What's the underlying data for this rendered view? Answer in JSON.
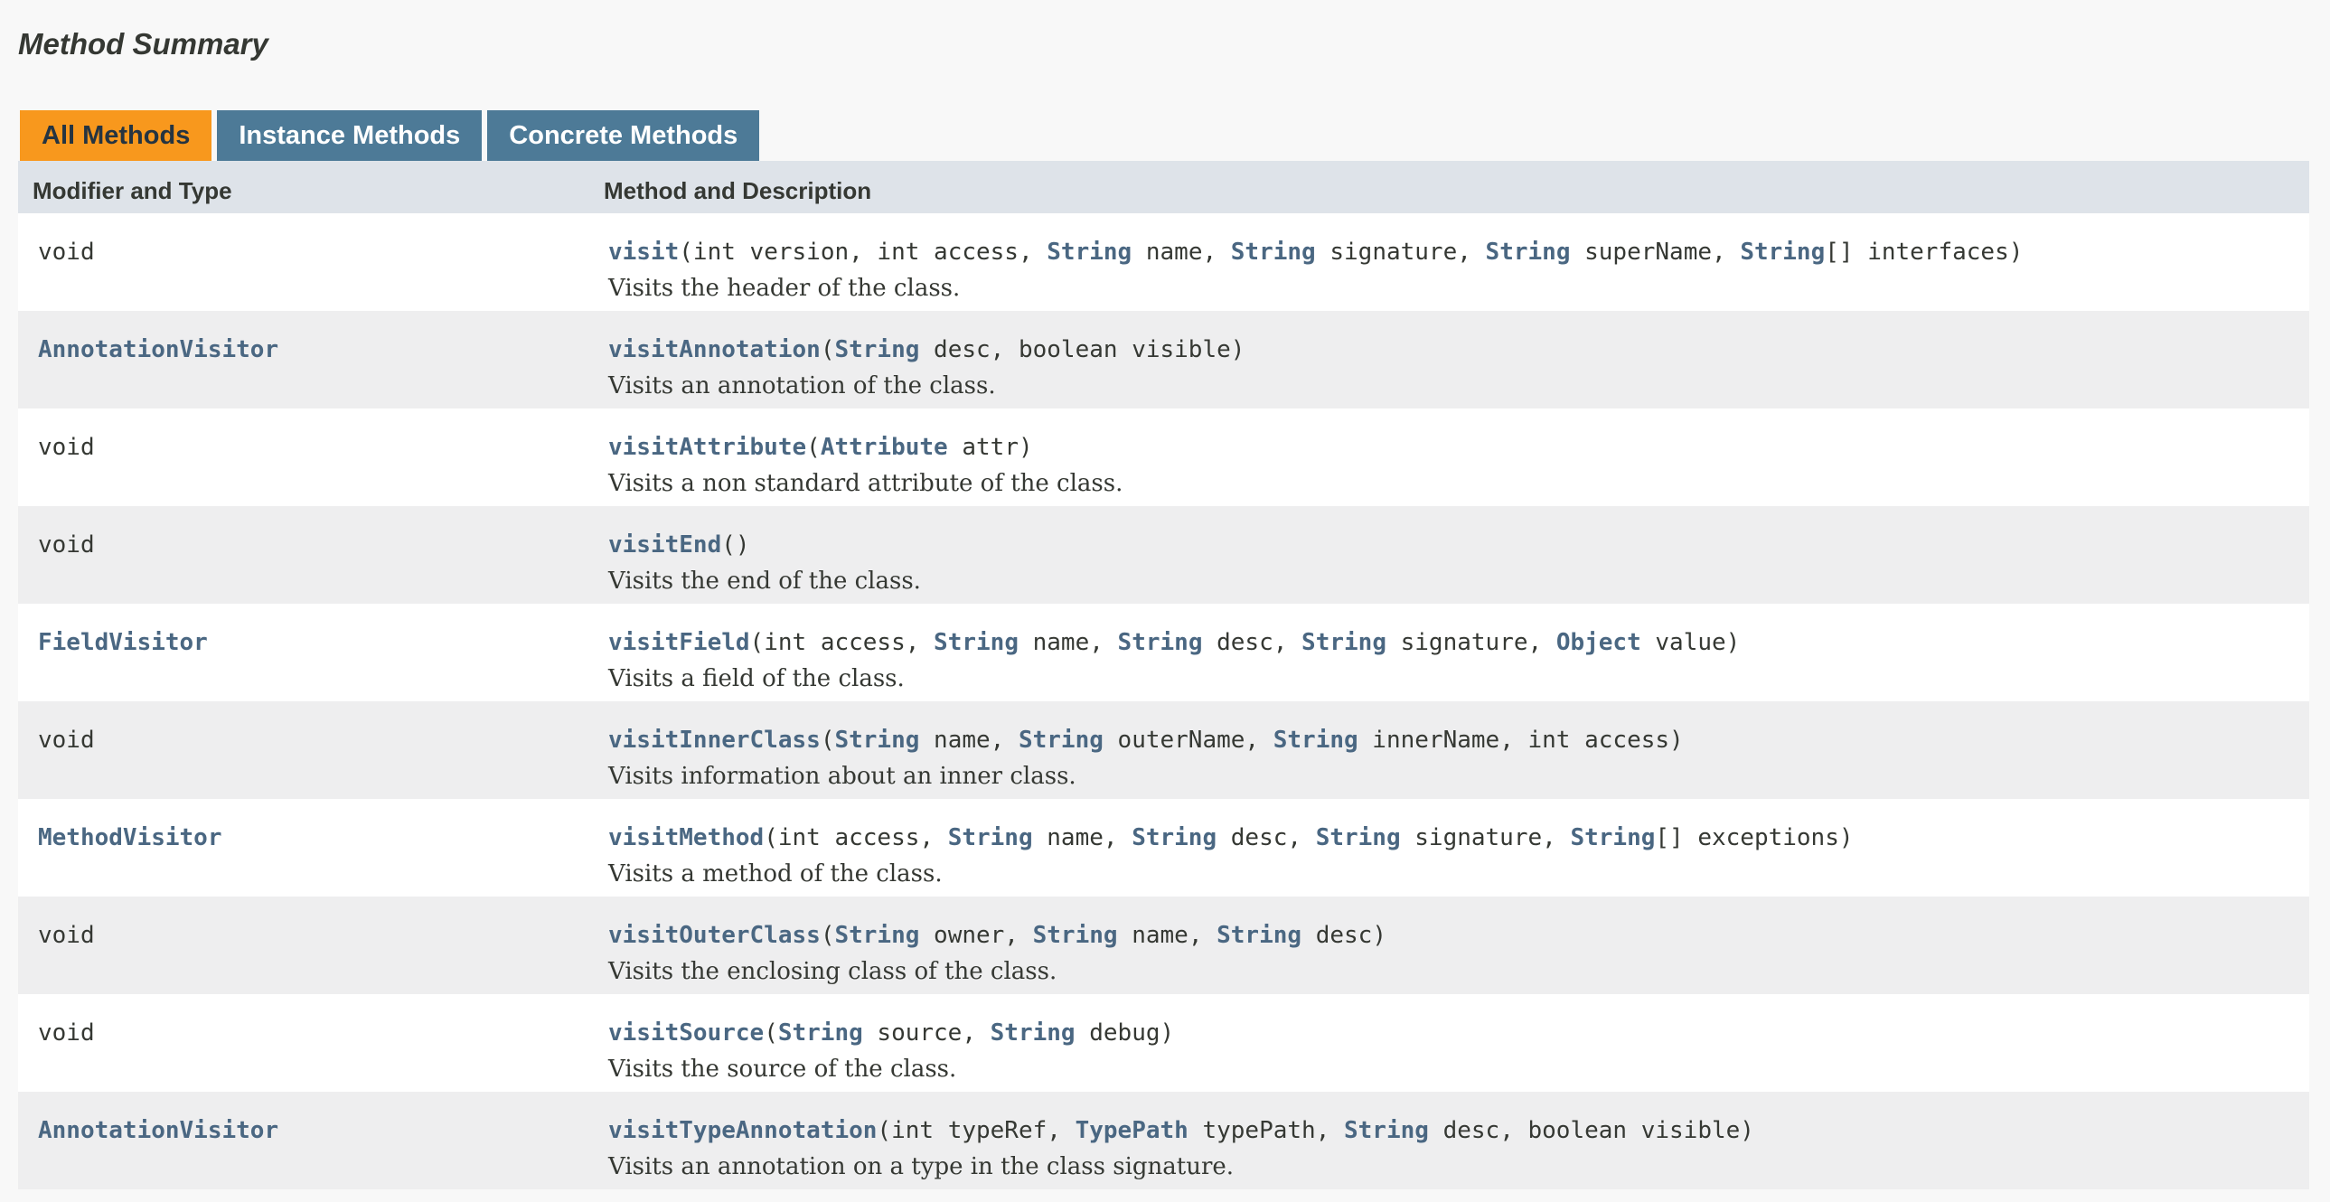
{
  "section": {
    "title": "Method Summary"
  },
  "tabs": [
    {
      "label": "All Methods",
      "active": true
    },
    {
      "label": "Instance Methods",
      "active": false
    },
    {
      "label": "Concrete Methods",
      "active": false
    }
  ],
  "columns": {
    "modifier": "Modifier and Type",
    "method": "Method and Description"
  },
  "colors": {
    "active_tab": "#f8981d",
    "tab": "#4d7a97",
    "link": "#4a6782",
    "header_bg": "#dee3e9",
    "alt_row": "#eeeeef"
  },
  "rows": [
    {
      "type": "void",
      "type_link": false,
      "sig": [
        {
          "k": "m",
          "t": "visit"
        },
        {
          "k": "p",
          "t": "(int version, int access, "
        },
        {
          "k": "t",
          "t": "String"
        },
        {
          "k": "p",
          "t": " name, "
        },
        {
          "k": "t",
          "t": "String"
        },
        {
          "k": "p",
          "t": " signature, "
        },
        {
          "k": "t",
          "t": "String"
        },
        {
          "k": "p",
          "t": " superName, "
        },
        {
          "k": "t",
          "t": "String"
        },
        {
          "k": "p",
          "t": "[] interfaces)"
        }
      ],
      "desc": "Visits the header of the class."
    },
    {
      "type": "AnnotationVisitor",
      "type_link": true,
      "sig": [
        {
          "k": "m",
          "t": "visitAnnotation"
        },
        {
          "k": "p",
          "t": "("
        },
        {
          "k": "t",
          "t": "String"
        },
        {
          "k": "p",
          "t": " desc, boolean visible)"
        }
      ],
      "desc": "Visits an annotation of the class."
    },
    {
      "type": "void",
      "type_link": false,
      "sig": [
        {
          "k": "m",
          "t": "visitAttribute"
        },
        {
          "k": "p",
          "t": "("
        },
        {
          "k": "t",
          "t": "Attribute"
        },
        {
          "k": "p",
          "t": " attr)"
        }
      ],
      "desc": "Visits a non standard attribute of the class."
    },
    {
      "type": "void",
      "type_link": false,
      "sig": [
        {
          "k": "m",
          "t": "visitEnd"
        },
        {
          "k": "p",
          "t": "()"
        }
      ],
      "desc": "Visits the end of the class."
    },
    {
      "type": "FieldVisitor",
      "type_link": true,
      "sig": [
        {
          "k": "m",
          "t": "visitField"
        },
        {
          "k": "p",
          "t": "(int access, "
        },
        {
          "k": "t",
          "t": "String"
        },
        {
          "k": "p",
          "t": " name, "
        },
        {
          "k": "t",
          "t": "String"
        },
        {
          "k": "p",
          "t": " desc, "
        },
        {
          "k": "t",
          "t": "String"
        },
        {
          "k": "p",
          "t": " signature, "
        },
        {
          "k": "t",
          "t": "Object"
        },
        {
          "k": "p",
          "t": " value)"
        }
      ],
      "desc": "Visits a field of the class."
    },
    {
      "type": "void",
      "type_link": false,
      "sig": [
        {
          "k": "m",
          "t": "visitInnerClass"
        },
        {
          "k": "p",
          "t": "("
        },
        {
          "k": "t",
          "t": "String"
        },
        {
          "k": "p",
          "t": " name, "
        },
        {
          "k": "t",
          "t": "String"
        },
        {
          "k": "p",
          "t": " outerName, "
        },
        {
          "k": "t",
          "t": "String"
        },
        {
          "k": "p",
          "t": " innerName, int access)"
        }
      ],
      "desc": "Visits information about an inner class."
    },
    {
      "type": "MethodVisitor",
      "type_link": true,
      "sig": [
        {
          "k": "m",
          "t": "visitMethod"
        },
        {
          "k": "p",
          "t": "(int access, "
        },
        {
          "k": "t",
          "t": "String"
        },
        {
          "k": "p",
          "t": " name, "
        },
        {
          "k": "t",
          "t": "String"
        },
        {
          "k": "p",
          "t": " desc, "
        },
        {
          "k": "t",
          "t": "String"
        },
        {
          "k": "p",
          "t": " signature, "
        },
        {
          "k": "t",
          "t": "String"
        },
        {
          "k": "p",
          "t": "[] exceptions)"
        }
      ],
      "desc": "Visits a method of the class."
    },
    {
      "type": "void",
      "type_link": false,
      "sig": [
        {
          "k": "m",
          "t": "visitOuterClass"
        },
        {
          "k": "p",
          "t": "("
        },
        {
          "k": "t",
          "t": "String"
        },
        {
          "k": "p",
          "t": " owner, "
        },
        {
          "k": "t",
          "t": "String"
        },
        {
          "k": "p",
          "t": " name, "
        },
        {
          "k": "t",
          "t": "String"
        },
        {
          "k": "p",
          "t": " desc)"
        }
      ],
      "desc": "Visits the enclosing class of the class."
    },
    {
      "type": "void",
      "type_link": false,
      "sig": [
        {
          "k": "m",
          "t": "visitSource"
        },
        {
          "k": "p",
          "t": "("
        },
        {
          "k": "t",
          "t": "String"
        },
        {
          "k": "p",
          "t": " source, "
        },
        {
          "k": "t",
          "t": "String"
        },
        {
          "k": "p",
          "t": " debug)"
        }
      ],
      "desc": "Visits the source of the class."
    },
    {
      "type": "AnnotationVisitor",
      "type_link": true,
      "sig": [
        {
          "k": "m",
          "t": "visitTypeAnnotation"
        },
        {
          "k": "p",
          "t": "(int typeRef, "
        },
        {
          "k": "t",
          "t": "TypePath"
        },
        {
          "k": "p",
          "t": " typePath, "
        },
        {
          "k": "t",
          "t": "String"
        },
        {
          "k": "p",
          "t": " desc, boolean visible)"
        }
      ],
      "desc": "Visits an annotation on a type in the class signature."
    }
  ]
}
